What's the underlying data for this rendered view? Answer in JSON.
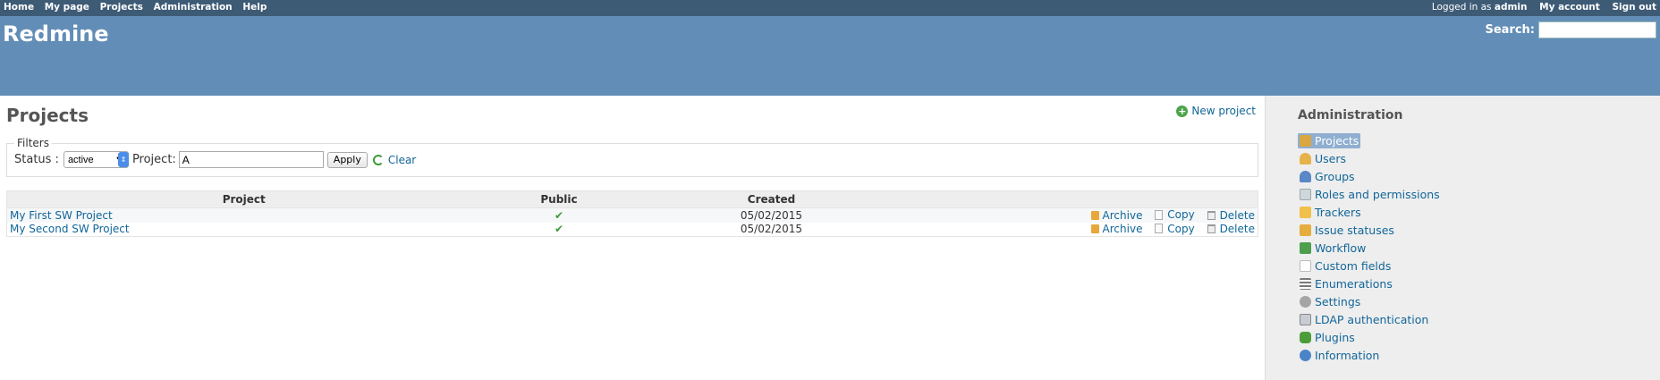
{
  "top_menu": {
    "links": [
      "Home",
      "My page",
      "Projects",
      "Administration",
      "Help"
    ],
    "logged_in_prefix": "Logged in as",
    "username": "admin",
    "my_account": "My account",
    "sign_out": "Sign out"
  },
  "header": {
    "title": "Redmine",
    "search_label": "Search:",
    "search_value": ""
  },
  "content": {
    "title": "Projects",
    "new_project": "New project",
    "filters": {
      "legend": "Filters",
      "status_label": "Status :",
      "status_selected": "active",
      "project_label": "Project:",
      "project_value": "A",
      "apply": "Apply",
      "clear": "Clear"
    },
    "table": {
      "headers": [
        "Project",
        "Public",
        "Created",
        ""
      ],
      "rows": [
        {
          "name": "My First SW Project",
          "public": "✔",
          "created": "05/02/2015"
        },
        {
          "name": "My Second SW Project",
          "public": "✔",
          "created": "05/02/2015"
        }
      ],
      "actions": {
        "archive": "Archive",
        "copy": "Copy",
        "delete": "Delete"
      }
    }
  },
  "sidebar": {
    "title": "Administration",
    "items": [
      {
        "label": "Projects",
        "icon": "projects-icon"
      },
      {
        "label": "Users",
        "icon": "users-icon"
      },
      {
        "label": "Groups",
        "icon": "groups-icon"
      },
      {
        "label": "Roles and permissions",
        "icon": "roles-icon"
      },
      {
        "label": "Trackers",
        "icon": "trackers-icon"
      },
      {
        "label": "Issue statuses",
        "icon": "issue-statuses-icon"
      },
      {
        "label": "Workflow",
        "icon": "workflow-icon"
      },
      {
        "label": "Custom fields",
        "icon": "custom-fields-icon"
      },
      {
        "label": "Enumerations",
        "icon": "enumerations-icon"
      },
      {
        "label": "Settings",
        "icon": "settings-icon"
      },
      {
        "label": "LDAP authentication",
        "icon": "ldap-icon"
      },
      {
        "label": "Plugins",
        "icon": "plugins-icon"
      },
      {
        "label": "Information",
        "icon": "information-icon"
      }
    ],
    "selected_index": 0
  }
}
